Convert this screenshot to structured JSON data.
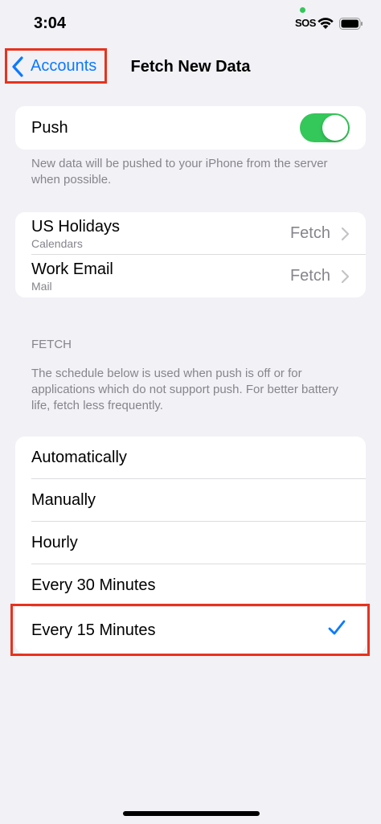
{
  "status_bar": {
    "time": "3:04",
    "sos": "SOS"
  },
  "nav": {
    "back_label": "Accounts",
    "title": "Fetch New Data"
  },
  "push": {
    "label": "Push",
    "enabled": true,
    "footer": "New data will be pushed to your iPhone from the server when possible."
  },
  "accounts": [
    {
      "name": "US Holidays",
      "type": "Calendars",
      "value": "Fetch"
    },
    {
      "name": "Work Email",
      "type": "Mail",
      "value": "Fetch"
    }
  ],
  "fetch_section": {
    "header": "FETCH",
    "footer": "The schedule below is used when push is off or for applications which do not support push. For better battery life, fetch less frequently.",
    "options": [
      {
        "label": "Automatically",
        "selected": false
      },
      {
        "label": "Manually",
        "selected": false
      },
      {
        "label": "Hourly",
        "selected": false
      },
      {
        "label": "Every 30 Minutes",
        "selected": false
      },
      {
        "label": "Every 15 Minutes",
        "selected": true
      }
    ]
  },
  "colors": {
    "accent": "#0a7aff",
    "toggle_on": "#34c759",
    "highlight": "#e8321e",
    "background": "#f2f1f6"
  }
}
